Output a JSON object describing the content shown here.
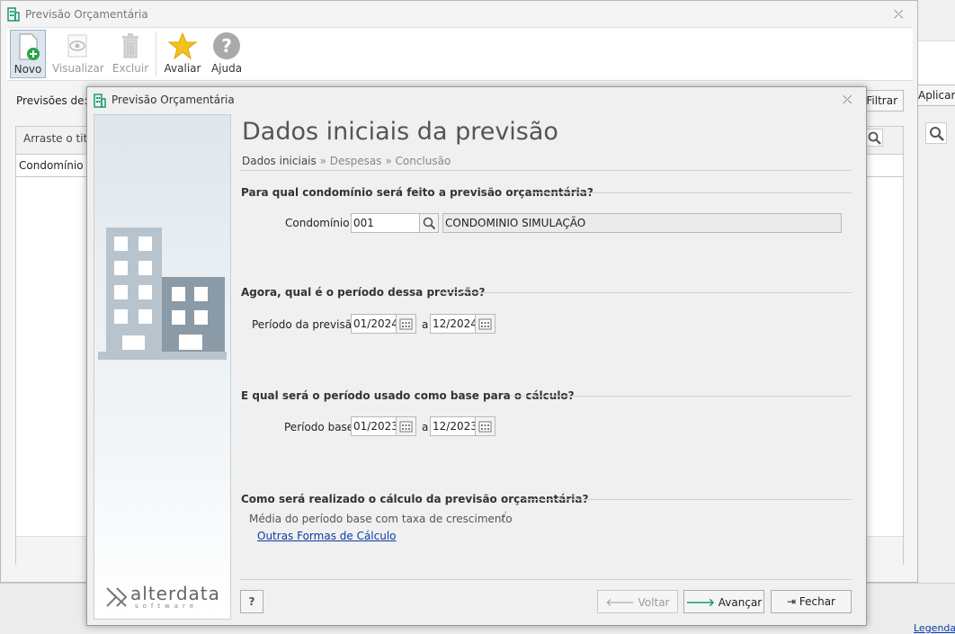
{
  "outer_window": {
    "title": "Previsão Orçamentária",
    "toolbar": [
      {
        "label": "Novo",
        "icon": "new-document-icon",
        "state": "active"
      },
      {
        "label": "Visualizar",
        "icon": "eye-document-icon",
        "state": "disabled"
      },
      {
        "label": "Excluir",
        "icon": "trash-icon",
        "state": "disabled"
      },
      {
        "label": "Avaliar",
        "icon": "star-icon",
        "state": "normal"
      },
      {
        "label": "Ajuda",
        "icon": "help-icon",
        "state": "normal"
      }
    ],
    "previsoes_label": "Previsões de:",
    "filtrar_label": "Filtrar",
    "aplicar_label": "Aplicar l",
    "group_hint": "Arraste o titu",
    "column_condominio": "Condomínio",
    "legenda": "Legenda"
  },
  "dialog": {
    "title": "Previsão Orçamentária",
    "heading": "Dados iniciais da previsão",
    "breadcrumb": {
      "current": "Dados iniciais",
      "sep": "»",
      "steps": [
        "Despesas",
        "Conclusão"
      ]
    },
    "section1": {
      "title": "Para qual condomínio será feito a previsão orçamentária?",
      "label": "Condomínio:",
      "code": "001",
      "name": "CONDOMINIO SIMULAÇÃO"
    },
    "section2": {
      "title": "Agora, qual é o período dessa previsão?",
      "label": "Período da previsão:",
      "from": "01/2024",
      "sep": "a",
      "to": "12/2024"
    },
    "section3": {
      "title": "E qual será o período usado como base para o cálculo?",
      "label": "Período base:",
      "from": "01/2023",
      "sep": "a",
      "to": "12/2023"
    },
    "section4": {
      "title": "Como será realizado o cálculo da previsão orçamentária?",
      "method": "Média do período base com taxa de crescimento",
      "info_icon": "info-icon",
      "link": "Outras Formas de Cálculo"
    },
    "brand": {
      "name": "alterdata",
      "sub": "software"
    },
    "buttons": {
      "help": "?",
      "voltar": "Voltar",
      "avancar": "Avançar",
      "fechar": "Fechar"
    }
  },
  "colors": {
    "accent_green": "#1a9a6c",
    "link_blue": "#0a3ca8",
    "building_dark": "#8a9aa6",
    "building_light": "#b7c4cd"
  }
}
